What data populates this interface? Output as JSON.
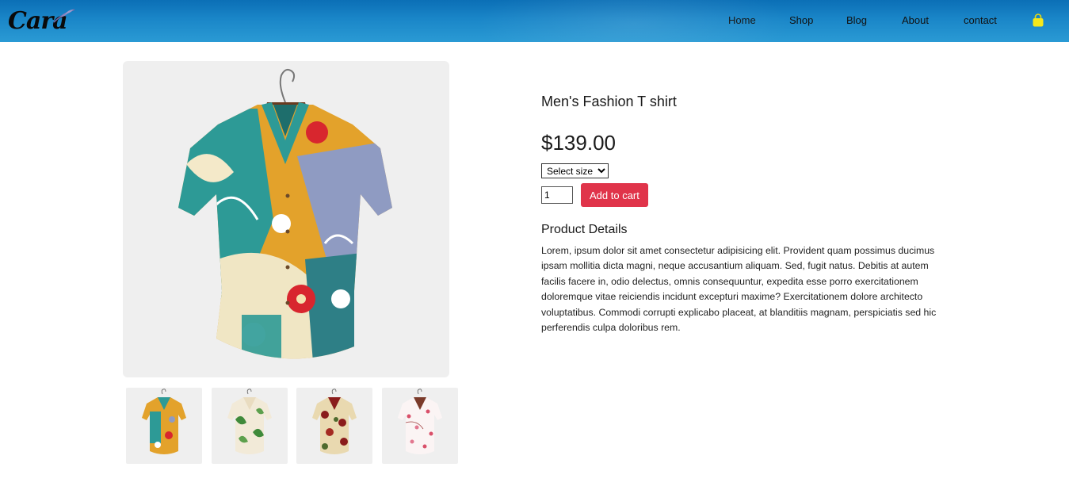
{
  "header": {
    "logo_text": "Cara",
    "nav": [
      {
        "label": "Home"
      },
      {
        "label": "Shop"
      },
      {
        "label": "Blog"
      },
      {
        "label": "About"
      },
      {
        "label": "contact"
      }
    ],
    "cart_icon": "shopping-bag-icon",
    "cart_color": "#f5e81b"
  },
  "product": {
    "title": "Men's Fashion T shirt",
    "price": "$139.00",
    "size_select": {
      "selected": "Select size"
    },
    "quantity": "1",
    "add_to_cart_label": "Add to cart",
    "details_heading": "Product Details",
    "details_text": "Lorem, ipsum dolor sit amet consectetur adipisicing elit. Provident quam possimus ducimus ipsam mollitia dicta magni, neque accusantium aliquam. Sed, fugit natus. Debitis at autem facilis facere in, odio delectus, omnis consequuntur, expedita esse porro exercitationem doloremque vitae reiciendis incidunt excepturi maxime? Exercitationem dolore architecto voluptatibus. Commodi corrupti explicabo placeat, at blanditiis magnam, perspiciatis sed hic perferendis culpa doloribus rem."
  },
  "gallery": {
    "main_image": "multicolor-floral-shirt",
    "thumbnails": [
      {
        "image": "multicolor-floral-shirt"
      },
      {
        "image": "green-leaf-shirt"
      },
      {
        "image": "red-floral-shirt"
      },
      {
        "image": "pink-blossom-shirt"
      }
    ]
  },
  "colors": {
    "header_blue": "#1a86c8",
    "button_red": "#e0344a",
    "image_bg": "#efefef"
  }
}
